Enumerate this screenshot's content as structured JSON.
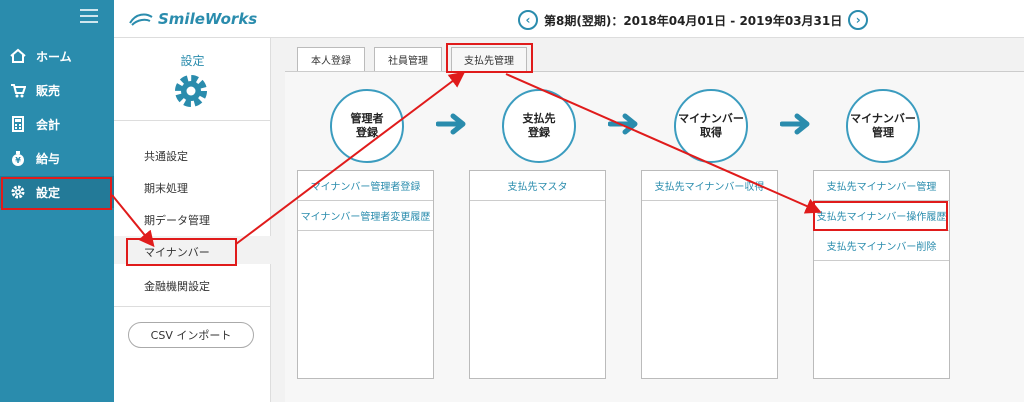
{
  "nav": {
    "items": [
      {
        "label": "ホーム",
        "icon": "home-icon"
      },
      {
        "label": "販売",
        "icon": "cart-icon"
      },
      {
        "label": "会計",
        "icon": "calculator-icon"
      },
      {
        "label": "給与",
        "icon": "money-bag-icon"
      },
      {
        "label": "設定",
        "icon": "gear-icon"
      }
    ]
  },
  "header": {
    "logo_text": "SmileWorks",
    "period": "第8期(翌期)：2018年04月01日 - 2019年03月31日",
    "prev_symbol": "‹",
    "next_symbol": "›"
  },
  "settings": {
    "title": "設定",
    "menu": [
      "共通設定",
      "期末処理",
      "期データ管理",
      "マイナンバー",
      "金融機関設定"
    ],
    "csv_button": "CSV インポート"
  },
  "tabs": [
    "本人登録",
    "社員管理",
    "支払先管理"
  ],
  "steps": [
    {
      "line1": "管理者",
      "line2": "登録"
    },
    {
      "line1": "支払先",
      "line2": "登録"
    },
    {
      "line1": "マイナンバー",
      "line2": "取得"
    },
    {
      "line1": "マイナンバー",
      "line2": "管理"
    }
  ],
  "columns": [
    [
      "マイナンバー管理者登録",
      "マイナンバー管理者変更履歴"
    ],
    [
      "支払先マスタ"
    ],
    [
      "支払先マイナンバー収得"
    ],
    [
      "支払先マイナンバー管理",
      "支払先マイナンバー操作履歴",
      "支払先マイナンバー削除"
    ]
  ],
  "colors": {
    "accent": "#2a8cad",
    "highlight": "#e01b1b"
  }
}
